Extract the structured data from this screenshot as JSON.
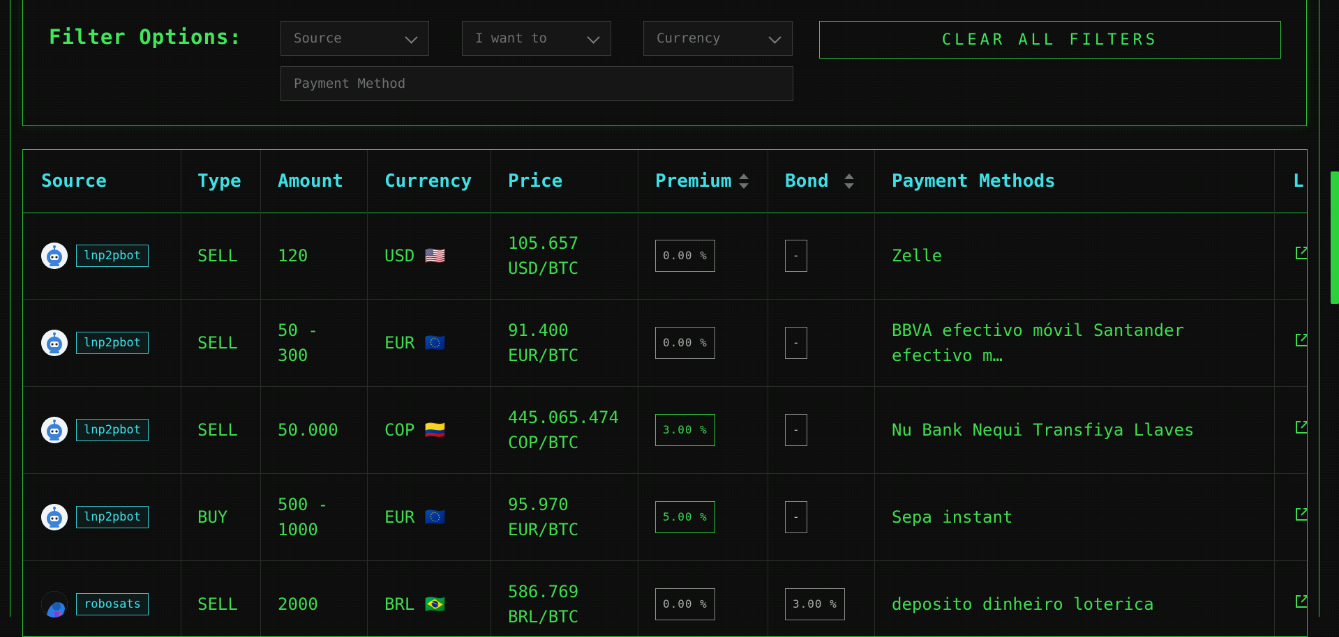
{
  "filters": {
    "title": "Filter Options:",
    "source_placeholder": "Source",
    "type_placeholder": "I want to",
    "currency_placeholder": "Currency",
    "payment_placeholder": "Payment Method",
    "clear_label": "CLEAR ALL FILTERS"
  },
  "table": {
    "headers": [
      "Source",
      "Type",
      "Amount",
      "Currency",
      "Price",
      "Premium",
      "Bond",
      "Payment Methods",
      "L:"
    ],
    "rows": [
      {
        "source": "lnp2pbot",
        "avatar": "robot-icon",
        "type": "SELL",
        "amount": "120",
        "currency": "USD 🇺🇸",
        "price": "105.657\nUSD/BTC",
        "premium": "0.00 %",
        "premium_highlight": false,
        "bond": "-",
        "payment": "Zelle"
      },
      {
        "source": "lnp2pbot",
        "avatar": "robot-icon",
        "type": "SELL",
        "amount": "50 -\n300",
        "currency": "EUR 🇪🇺",
        "price": "91.400\nEUR/BTC",
        "premium": "0.00 %",
        "premium_highlight": false,
        "bond": "-",
        "payment": "BBVA efectivo móvil Santander\nefectivo m…"
      },
      {
        "source": "lnp2pbot",
        "avatar": "robot-icon",
        "type": "SELL",
        "amount": "50.000",
        "currency": "COP 🇨🇴",
        "price": "445.065.474\nCOP/BTC",
        "premium": "3.00 %",
        "premium_highlight": true,
        "bond": "-",
        "payment": "Nu Bank Nequi Transfiya Llaves"
      },
      {
        "source": "lnp2pbot",
        "avatar": "robot-icon",
        "type": "BUY",
        "amount": "500 -\n1000",
        "currency": "EUR 🇪🇺",
        "price": "95.970\nEUR/BTC",
        "premium": "5.00 %",
        "premium_highlight": true,
        "bond": "-",
        "payment": "Sepa instant"
      },
      {
        "source": "robosats",
        "avatar": "robosats-icon",
        "type": "SELL",
        "amount": "2000",
        "currency": "BRL 🇧🇷",
        "price": "586.769\nBRL/BTC",
        "premium": "0.00 %",
        "premium_highlight": false,
        "bond": "3.00 %",
        "payment": "deposito dinheiro loterica"
      }
    ]
  },
  "colors": {
    "accent": "#3fdc4f",
    "header": "#3ee0e6",
    "border": "#28c83a"
  }
}
